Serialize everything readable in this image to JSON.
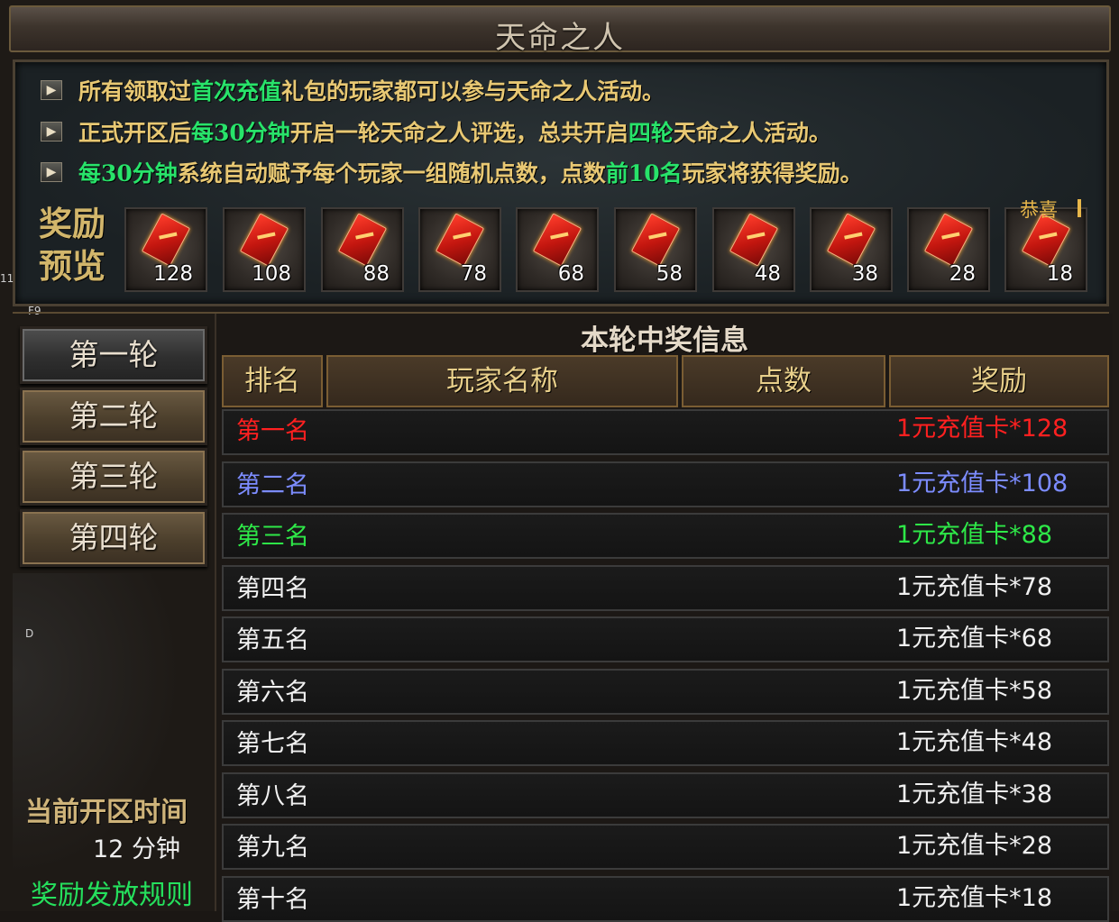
{
  "window": {
    "title": "天命之人"
  },
  "rules": [
    {
      "parts": [
        {
          "text": "所有领取过",
          "hl": false
        },
        {
          "text": "首次充值",
          "hl": true
        },
        {
          "text": "礼包的玩家都可以参与天命之人活动。",
          "hl": false
        }
      ]
    },
    {
      "parts": [
        {
          "text": "正式开区后",
          "hl": false
        },
        {
          "text": "每30分钟",
          "hl": true
        },
        {
          "text": "开启一轮天命之人评选，总共开启",
          "hl": false
        },
        {
          "text": "四轮",
          "hl": true
        },
        {
          "text": "天命之人活动。",
          "hl": false
        }
      ]
    },
    {
      "parts": [
        {
          "text": "每30分钟",
          "hl": true
        },
        {
          "text": "系统自动赋予每个玩家一组随机点数，点数",
          "hl": false
        },
        {
          "text": "前10名",
          "hl": true
        },
        {
          "text": "玩家将获得奖励。",
          "hl": false
        }
      ]
    }
  ],
  "reward_preview": {
    "label_line1": "奖励",
    "label_line2": "预览",
    "amounts": [
      "128",
      "108",
      "88",
      "78",
      "68",
      "58",
      "48",
      "38",
      "28",
      "18"
    ],
    "icon": "red-recharge-card-icon",
    "congrats_text": "恭喜"
  },
  "side_tags": {
    "a": "11",
    "b": "F9",
    "c": "D"
  },
  "rounds": {
    "items": [
      "第一轮",
      "第二轮",
      "第三轮",
      "第四轮"
    ],
    "active_index": 0
  },
  "open_time": {
    "label": "当前开区时间",
    "value": "12 分钟"
  },
  "rules_link": "奖励发放规则",
  "winners": {
    "heading": "本轮中奖信息",
    "columns": [
      "排名",
      "玩家名称",
      "点数",
      "奖励"
    ],
    "rows": [
      {
        "rank": "第一名",
        "player": "",
        "points": "",
        "prize": "1元充值卡*128"
      },
      {
        "rank": "第二名",
        "player": "",
        "points": "",
        "prize": "1元充值卡*108"
      },
      {
        "rank": "第三名",
        "player": "",
        "points": "",
        "prize": "1元充值卡*88"
      },
      {
        "rank": "第四名",
        "player": "",
        "points": "",
        "prize": "1元充值卡*78"
      },
      {
        "rank": "第五名",
        "player": "",
        "points": "",
        "prize": "1元充值卡*68"
      },
      {
        "rank": "第六名",
        "player": "",
        "points": "",
        "prize": "1元充值卡*58"
      },
      {
        "rank": "第七名",
        "player": "",
        "points": "",
        "prize": "1元充值卡*48"
      },
      {
        "rank": "第八名",
        "player": "",
        "points": "",
        "prize": "1元充值卡*38"
      },
      {
        "rank": "第九名",
        "player": "",
        "points": "",
        "prize": "1元充值卡*28"
      },
      {
        "rank": "第十名",
        "player": "",
        "points": "",
        "prize": "1元充值卡*18"
      }
    ]
  },
  "colors": {
    "highlight": "#28e36a",
    "rule_text": "#e8c873",
    "rank1": "#ff2020",
    "rank2": "#7c8cff",
    "rank3": "#2ee848"
  }
}
